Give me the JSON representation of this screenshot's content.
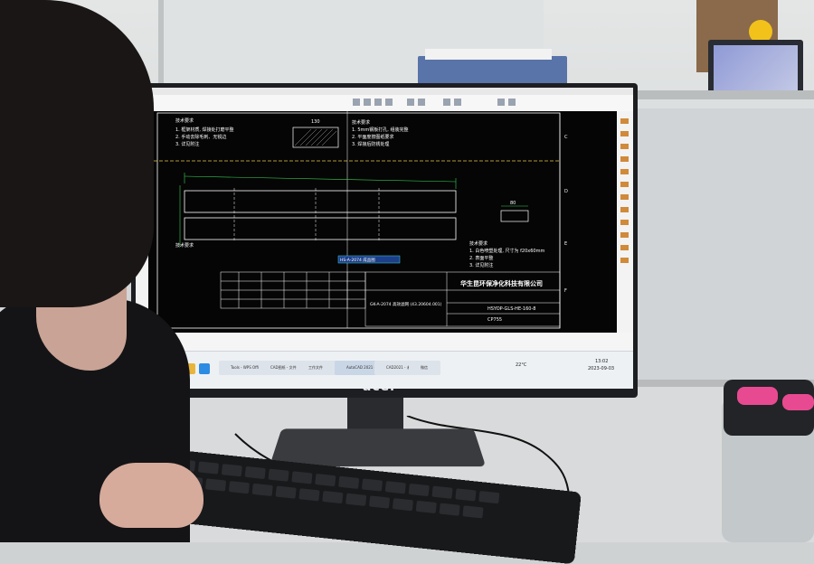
{
  "scene": {
    "monitor_brand": "acer"
  },
  "cad_drawing": {
    "tech_req_title": "技术要求",
    "top_notes": [
      "1. 框架材质, 焊接处打磨平整",
      "2. 手动去除毛刺、无锐边",
      "3. 详见附注"
    ],
    "right_notes": [
      "1. 5mm钢板打孔, 组装完整",
      "2. 平面度按图纸要求",
      "3. 焊接后防锈处理"
    ],
    "lower_notes": [
      "1. 白色喷塑处理, 尺寸为 f20x60mm",
      "2. 表面平整",
      "3. 详见附注"
    ],
    "dimension_label_small": "130",
    "dimension_label_part": "80",
    "part_number_tag": "HS-A-2074 成品图",
    "company_name": "华生昆环保净化科技有限公司",
    "drawing_code": "HSYOP-GLS-HE-160-8",
    "drawing_ref": "GK-A-2074 高效滤网 (43.20604.001)",
    "material_code": "CP755",
    "border_letters": [
      "C",
      "D",
      "E",
      "F"
    ]
  },
  "taskbar": {
    "apps": [
      {
        "label": "Tools - WPS Office",
        "color": "#d23b3b"
      },
      {
        "label": "CAD图纸 - 文件夹",
        "color": "#e0a43a"
      },
      {
        "label": "工作文件",
        "color": "#4a7fd0"
      },
      {
        "label": "AutoCAD 2021 - 图纸",
        "color": "#c43c3c"
      },
      {
        "label": "CAD2021 - 未命名",
        "color": "#c43c3c"
      },
      {
        "label": "微信",
        "color": "#2fa84f"
      }
    ],
    "weather": "22°C",
    "time": "13:02",
    "date": "2023-09-03"
  },
  "colors": {
    "cad_background": "#050505",
    "cad_lines": "#ffffff",
    "cad_green": "#39d353",
    "cad_yellow": "#e6c84a",
    "cad_cyan": "#3fd0e0"
  }
}
